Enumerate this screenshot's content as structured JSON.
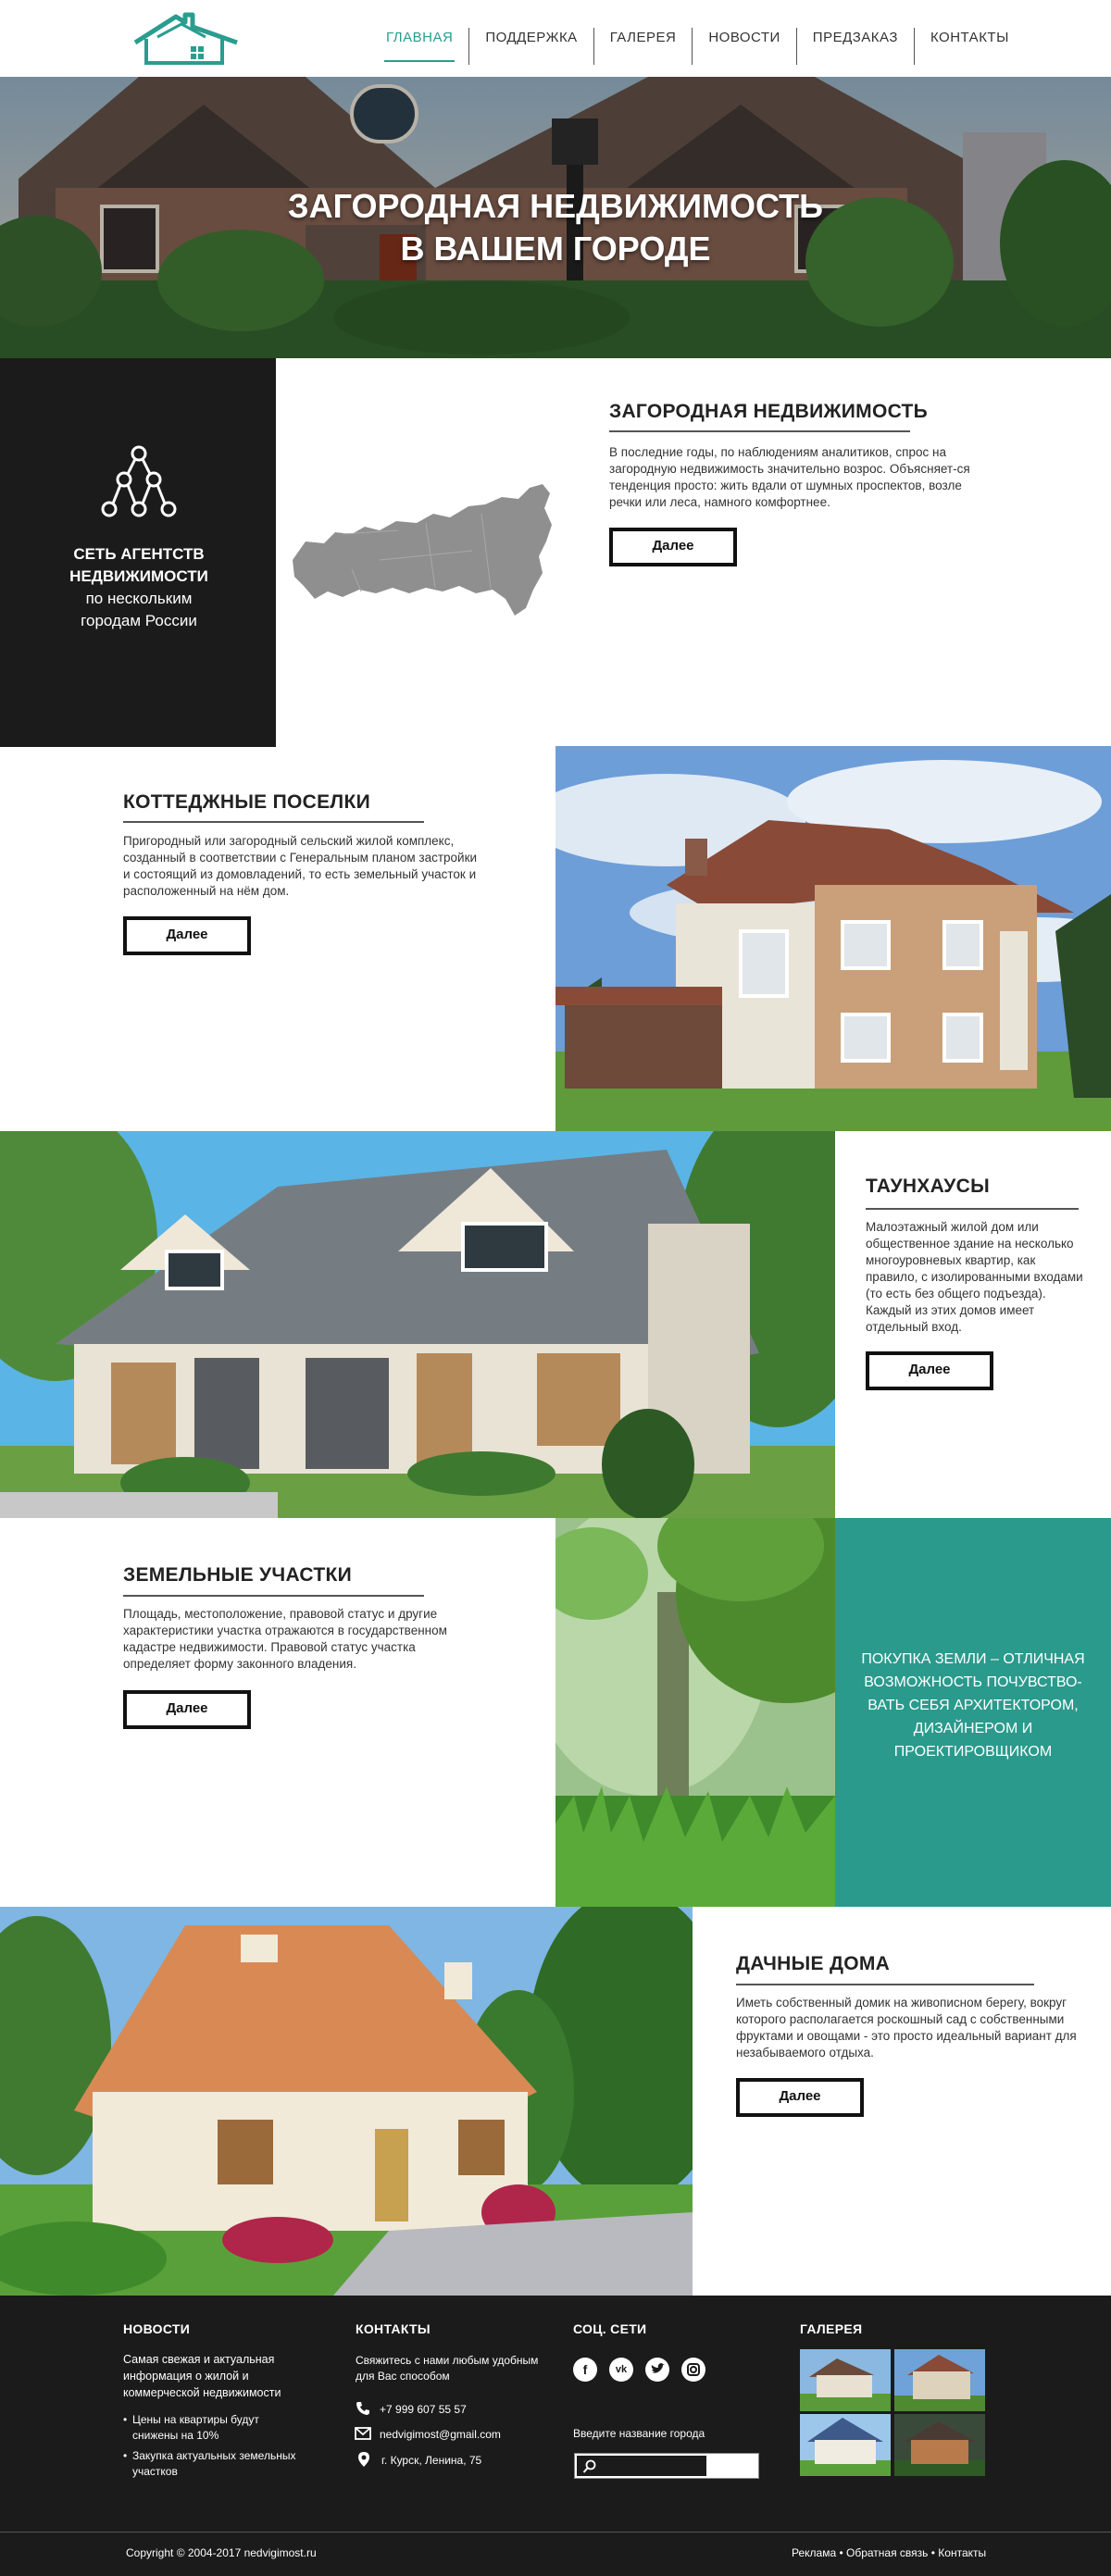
{
  "colors": {
    "accent": "#2a9d8f",
    "teal_block": "#2a9a8c",
    "dark": "#1b1b1b"
  },
  "header": {
    "logo_icon": "house-logo-icon",
    "nav": [
      {
        "label": "ГЛАВНАЯ",
        "active": true
      },
      {
        "label": "ПОДДЕРЖКА",
        "active": false
      },
      {
        "label": "ГАЛЕРЕЯ",
        "active": false
      },
      {
        "label": "НОВОСТИ",
        "active": false
      },
      {
        "label": "ПРЕДЗАКАЗ",
        "active": false
      },
      {
        "label": "КОНТАКТЫ",
        "active": false
      }
    ]
  },
  "hero": {
    "title": "ЗАГОРОДНАЯ НЕДВИЖИМОСТЬ\nВ ВАШЕМ ГОРОДЕ"
  },
  "agency": {
    "icon": "network-tree-icon",
    "line1": "СЕТЬ АГЕНТСТВ",
    "line2": "НЕДВИЖИМОСТИ",
    "line3": "по нескольким",
    "line4": "городам России",
    "map_icon": "russia-map-icon"
  },
  "sections": {
    "country": {
      "title": "ЗАГОРОДНАЯ НЕДВИЖИМОСТЬ",
      "text": "В последние годы, по наблюдениям аналитиков, спрос на загородную недвижимость значительно возрос. Объясняет-ся тенденция просто: жить вдали от шумных проспектов, возле речки или леса, намного комфортнее.",
      "button": "Далее"
    },
    "cottage": {
      "title": "КОТТЕДЖНЫЕ ПОСЕЛКИ",
      "text": "Пригородный или загородный сельский жилой комплекс, созданный в соответствии с Генеральным планом застройки и состоящий из домовладений, то есть земельный участок и расположенный на нём дом.",
      "button": "Далее"
    },
    "townhouse": {
      "title": "ТАУНХАУСЫ",
      "text": "Малоэтажный жилой дом или общественное здание на несколько многоуровневых квартир, как правило, с изолированными входами (то есть без общего подъезда). Каждый из этих домов имеет отдельный вход.",
      "button": "Далее"
    },
    "land": {
      "title": "ЗЕМЕЛЬНЫЕ УЧАСТКИ",
      "text": "Площадь, местоположение, правовой статус и другие характеристики участка отражаются в государственном кадастре недвижимости. Правовой статус участка определяет форму законного владения.",
      "button": "Далее",
      "teal_text": "ПОКУПКА ЗЕМЛИ – ОТЛИЧНАЯ ВОЗМОЖНОСТЬ ПОЧУВСТВО-ВАТЬ СЕБЯ АРХИТЕКТОРОМ, ДИЗАЙНЕРОМ И ПРОЕКТИРОВЩИКОМ"
    },
    "dacha": {
      "title": "ДАЧНЫЕ ДОМА",
      "text": "Иметь собственный домик на живописном берегу, вокруг которого располагается роскошный сад с собственными фруктами и овощами - это просто идеальный вариант для незабываемого отдыха.",
      "button": "Далее"
    }
  },
  "footer": {
    "news": {
      "heading": "НОВОСТИ",
      "intro": "Самая свежая и актуальная информация о жилой и коммерческой недвижимости",
      "items": [
        "Цены на квартиры будут снижены на 10%",
        "Закупка актуальных земельных участков"
      ]
    },
    "contacts": {
      "heading": "КОНТАКТЫ",
      "intro": "Свяжитесь с нами любым удобным для Вас способом",
      "phone": "+7 999 607 55 57",
      "email": "nedvigimost@gmail.com",
      "address": "г. Курск, Ленина, 75"
    },
    "social": {
      "heading": "СОЦ. СЕТИ",
      "icons": [
        "facebook-icon",
        "vk-icon",
        "twitter-icon",
        "instagram-icon"
      ],
      "city_label": "Введите название города",
      "search_placeholder": ""
    },
    "gallery": {
      "heading": "ГАЛЕРЕЯ"
    },
    "copyright": "Copyright © 2004-2017 nedvigimost.ru",
    "links": "Реклама • Обратная связь • Контакты"
  }
}
